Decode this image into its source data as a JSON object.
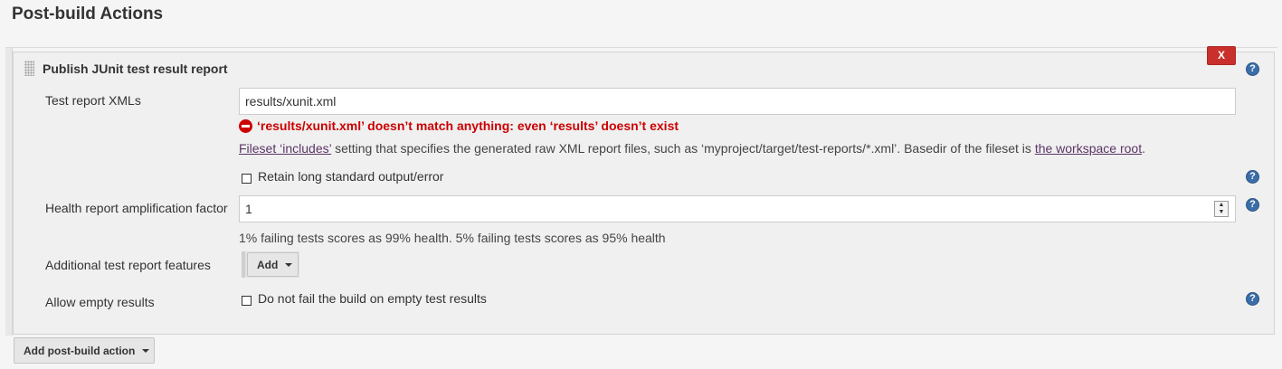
{
  "section_title": "Post-build Actions",
  "panel": {
    "title": "Publish JUnit test result report",
    "delete_label": "X",
    "help_symbol": "?"
  },
  "fields": {
    "test_report_xmls": {
      "label": "Test report XMLs",
      "value": "results/xunit.xml",
      "error": "‘results/xunit.xml’ doesn’t match anything: even ‘results’ doesn’t exist",
      "desc_link1": "Fileset ‘includes’",
      "desc_middle": " setting that specifies the generated raw XML report files, such as ‘myproject/target/test-reports/*.xml’. Basedir of the fileset is ",
      "desc_link2": "the workspace root",
      "desc_end": "."
    },
    "retain_output": {
      "label": "Retain long standard output/error",
      "checked": false
    },
    "health_factor": {
      "label": "Health report amplification factor",
      "value": "1",
      "desc": "1% failing tests scores as 99% health. 5% failing tests scores as 95% health"
    },
    "additional_features": {
      "label": "Additional test report features",
      "add_label": "Add"
    },
    "allow_empty": {
      "label": "Allow empty results",
      "checkbox_label": "Do not fail the build on empty test results",
      "checked": false
    }
  },
  "add_post_build_action": "Add post-build action",
  "colors": {
    "error": "#cc0000",
    "delete_button": "#c9302c",
    "help_icon": "#3b6ea8",
    "link": "#5c3566"
  },
  "icons": [
    "drag-handle-icon",
    "help-icon",
    "error-icon",
    "caret-down-icon",
    "spinner-icon"
  ]
}
